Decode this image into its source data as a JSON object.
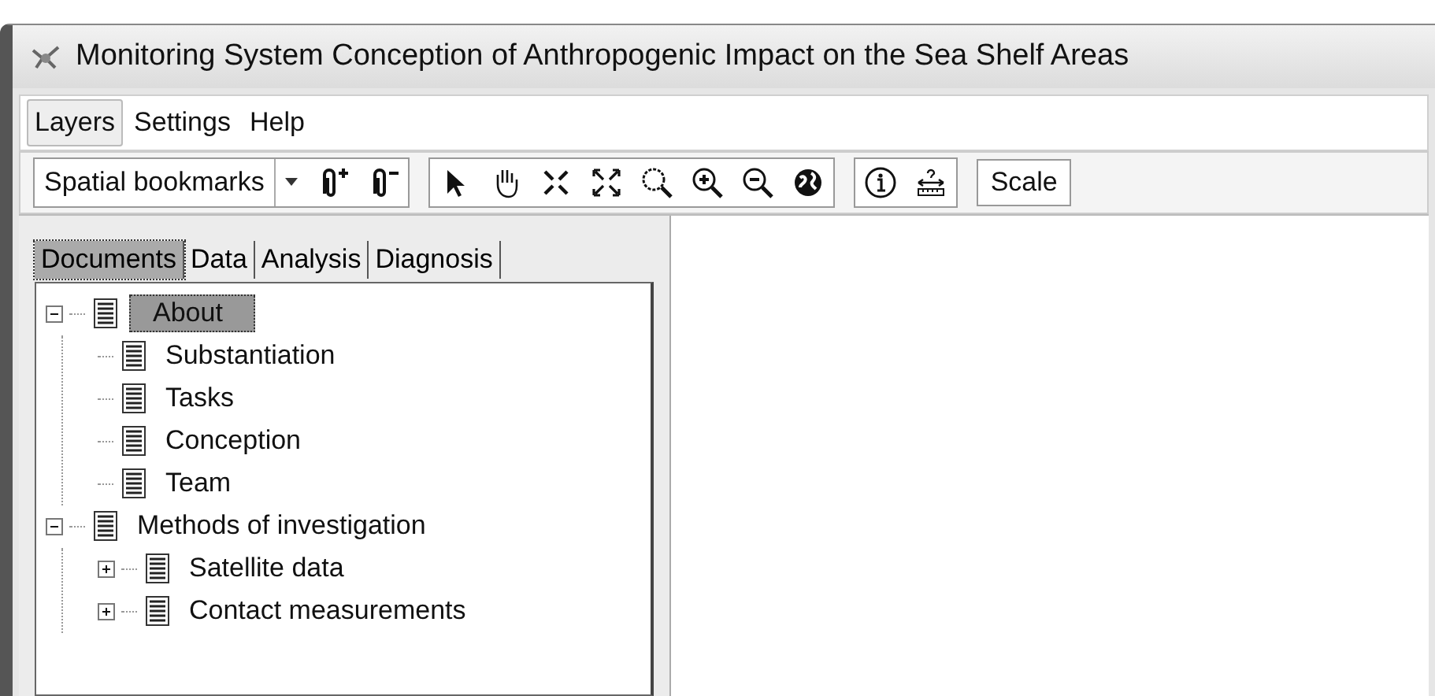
{
  "window": {
    "title": "Monitoring System Conception of Anthropogenic Impact on the Sea Shelf Areas"
  },
  "menu": [
    {
      "label": "Layers",
      "selected": true
    },
    {
      "label": "Settings",
      "selected": false
    },
    {
      "label": "Help",
      "selected": false
    }
  ],
  "toolbar": {
    "bookmarks": {
      "value": "Spatial bookmarks"
    },
    "groups": [
      [
        {
          "kind": "bookmark-add"
        },
        {
          "kind": "bookmark-remove"
        }
      ],
      [
        {
          "kind": "pointer"
        },
        {
          "kind": "pan"
        },
        {
          "kind": "shrink"
        },
        {
          "kind": "expand"
        },
        {
          "kind": "zoom-area"
        },
        {
          "kind": "zoom-in"
        },
        {
          "kind": "zoom-out"
        },
        {
          "kind": "globe"
        }
      ],
      [
        {
          "kind": "info"
        },
        {
          "kind": "measure"
        }
      ]
    ],
    "scale": {
      "value": "Scale"
    }
  },
  "tabs": [
    {
      "label": "Documents",
      "selected": true
    },
    {
      "label": "Data",
      "selected": false
    },
    {
      "label": "Analysis",
      "selected": false
    },
    {
      "label": "Diagnosis",
      "selected": false
    }
  ],
  "tree": [
    {
      "label": "About",
      "selected": true,
      "expanded": true,
      "children": [
        {
          "label": "Substantiation",
          "selected": false
        },
        {
          "label": "Tasks",
          "selected": false
        },
        {
          "label": "Conception",
          "selected": false
        },
        {
          "label": "Team",
          "selected": false
        }
      ]
    },
    {
      "label": "Methods of investigation",
      "selected": false,
      "expanded": true,
      "children": [
        {
          "label": "Satellite data",
          "selected": false,
          "expanded": false
        },
        {
          "label": "Contact measurements",
          "selected": false,
          "expanded": false
        }
      ]
    }
  ]
}
